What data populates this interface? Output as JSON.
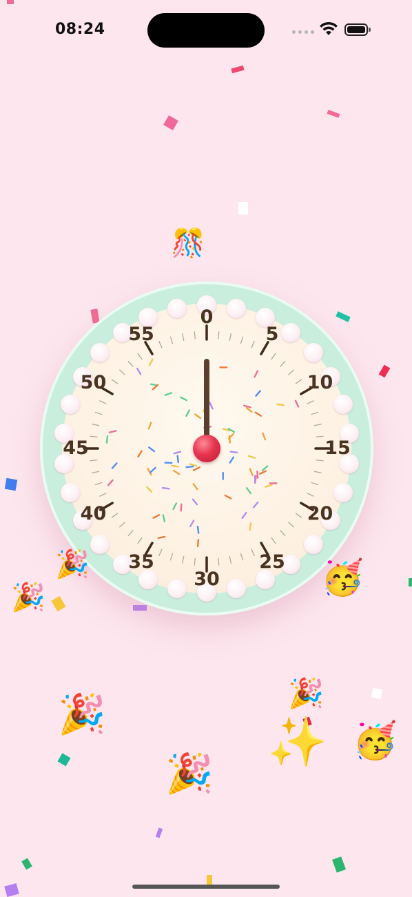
{
  "status_bar": {
    "time": "08:24"
  },
  "timer": {
    "numbers": [
      "0",
      "5",
      "10",
      "15",
      "20",
      "25",
      "30",
      "35",
      "40",
      "45",
      "50",
      "55"
    ],
    "hand_minutes": 0
  },
  "colors": {
    "background": "#fde6ee",
    "dial_rim": "#c9eedd",
    "dial_face": "#fdf0e1",
    "hand": "#5a3f2e",
    "knob": "#e6344e",
    "numerals": "#4a3320"
  },
  "decorations": [
    "party-popper",
    "partying-face",
    "sparkles",
    "confetti"
  ]
}
